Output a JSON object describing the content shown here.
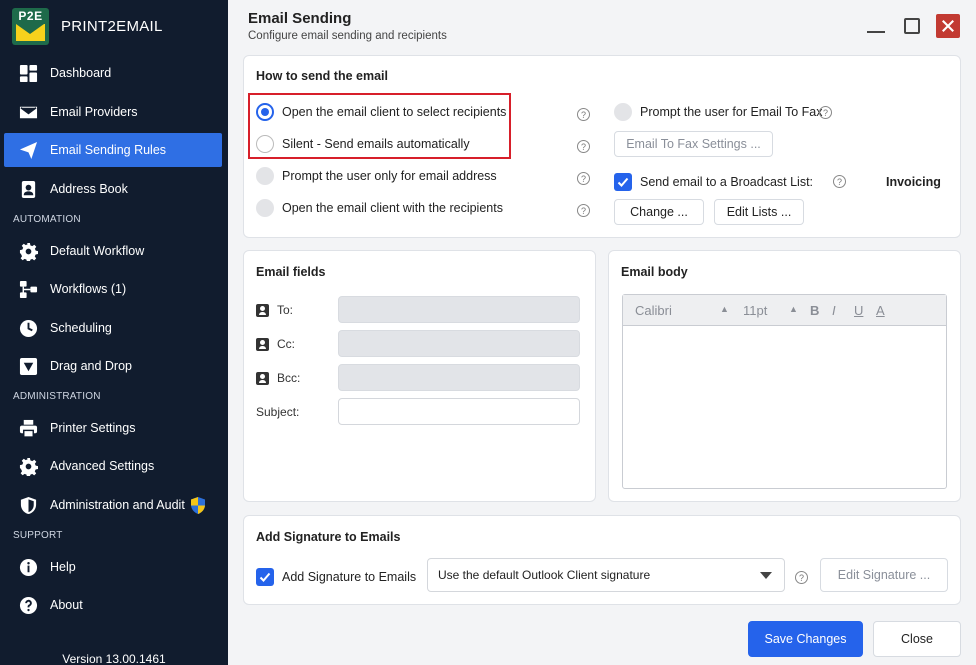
{
  "app": {
    "name": "PRINT2EMAIL",
    "logo_text": "P2E",
    "version": "Version 13.00.1461"
  },
  "sidebar": {
    "items": [
      {
        "label": "Dashboard"
      },
      {
        "label": "Email Providers"
      },
      {
        "label": "Email Sending Rules",
        "active": true
      },
      {
        "label": "Address Book"
      },
      {
        "label": "Default Workflow"
      },
      {
        "label": "Workflows (1)"
      },
      {
        "label": "Scheduling"
      },
      {
        "label": "Drag and Drop"
      },
      {
        "label": "Printer Settings"
      },
      {
        "label": "Advanced Settings"
      },
      {
        "label": "Administration and Audit"
      },
      {
        "label": "Help"
      },
      {
        "label": "About"
      }
    ],
    "sections": {
      "automation": "AUTOMATION",
      "administration": "ADMINISTRATION",
      "support": "SUPPORT"
    }
  },
  "header": {
    "title": "Email Sending",
    "subtitle": "Configure email sending and recipients"
  },
  "how_to_send": {
    "title": "How to send the email",
    "options": [
      {
        "label": "Open the email client to select recipients",
        "selected": true
      },
      {
        "label": "Silent - Send emails automatically",
        "selected": false
      },
      {
        "label": "Prompt the user only for email address",
        "selected": false
      },
      {
        "label": "Open the email client with the recipients",
        "selected": false
      }
    ],
    "fax_prompt_label": "Prompt the user for Email To Fax",
    "fax_settings_button": "Email To Fax Settings ...",
    "broadcast_label": "Send email to a Broadcast List:",
    "broadcast_checked": true,
    "broadcast_value": "Invoicing",
    "change_button": "Change ...",
    "edit_lists_button": "Edit Lists ..."
  },
  "email_fields": {
    "title": "Email fields",
    "to_label": "To:",
    "cc_label": "Cc:",
    "bcc_label": "Bcc:",
    "subject_label": "Subject:"
  },
  "email_body": {
    "title": "Email body",
    "font": "Calibri",
    "size": "11pt",
    "bold": "B",
    "italic": "I",
    "underline": "U",
    "color": "A"
  },
  "signature": {
    "title": "Add Signature to Emails",
    "checkbox_label": "Add Signature to Emails",
    "checked": true,
    "select_value": "Use the default Outlook Client signature",
    "edit_button": "Edit Signature ..."
  },
  "footer": {
    "save": "Save Changes",
    "close": "Close"
  },
  "colors": {
    "sidebar_bg": "#111c2e",
    "accent": "#2563eb",
    "highlight": "#d71f2a"
  }
}
